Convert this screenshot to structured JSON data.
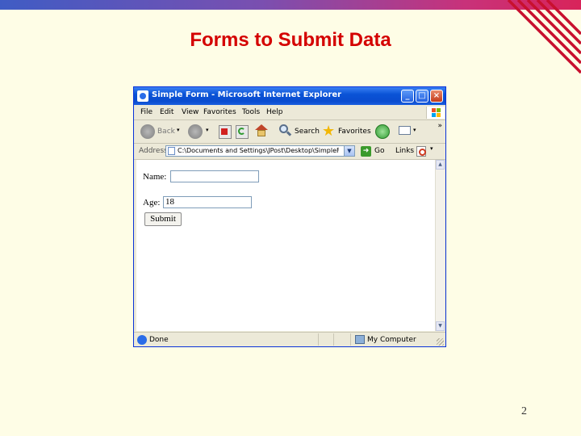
{
  "slide": {
    "title": "Forms to Submit Data",
    "page_number": "2"
  },
  "browser": {
    "window_title": "Simple Form - Microsoft Internet Explorer",
    "menu": [
      "File",
      "Edit",
      "View",
      "Favorites",
      "Tools",
      "Help"
    ],
    "toolbar": {
      "back_label": "Back",
      "search_label": "Search",
      "favorites_label": "Favorites"
    },
    "address": {
      "label": "Address",
      "value": "C:\\Documents and Settings\\JPost\\Desktop\\SimpleForm.ht",
      "go_label": "Go",
      "links_label": "Links"
    },
    "status": {
      "left_text": "Done",
      "zone_text": "My Computer"
    }
  },
  "form": {
    "name_label": "Name:",
    "name_value": "",
    "age_label": "Age:",
    "age_value": "18",
    "submit_label": "Submit"
  },
  "colors": {
    "slide_background": "#fefde6",
    "title_red": "#d40000",
    "xp_blue": "#0a53d6",
    "accent_pink": "#c8327a"
  }
}
